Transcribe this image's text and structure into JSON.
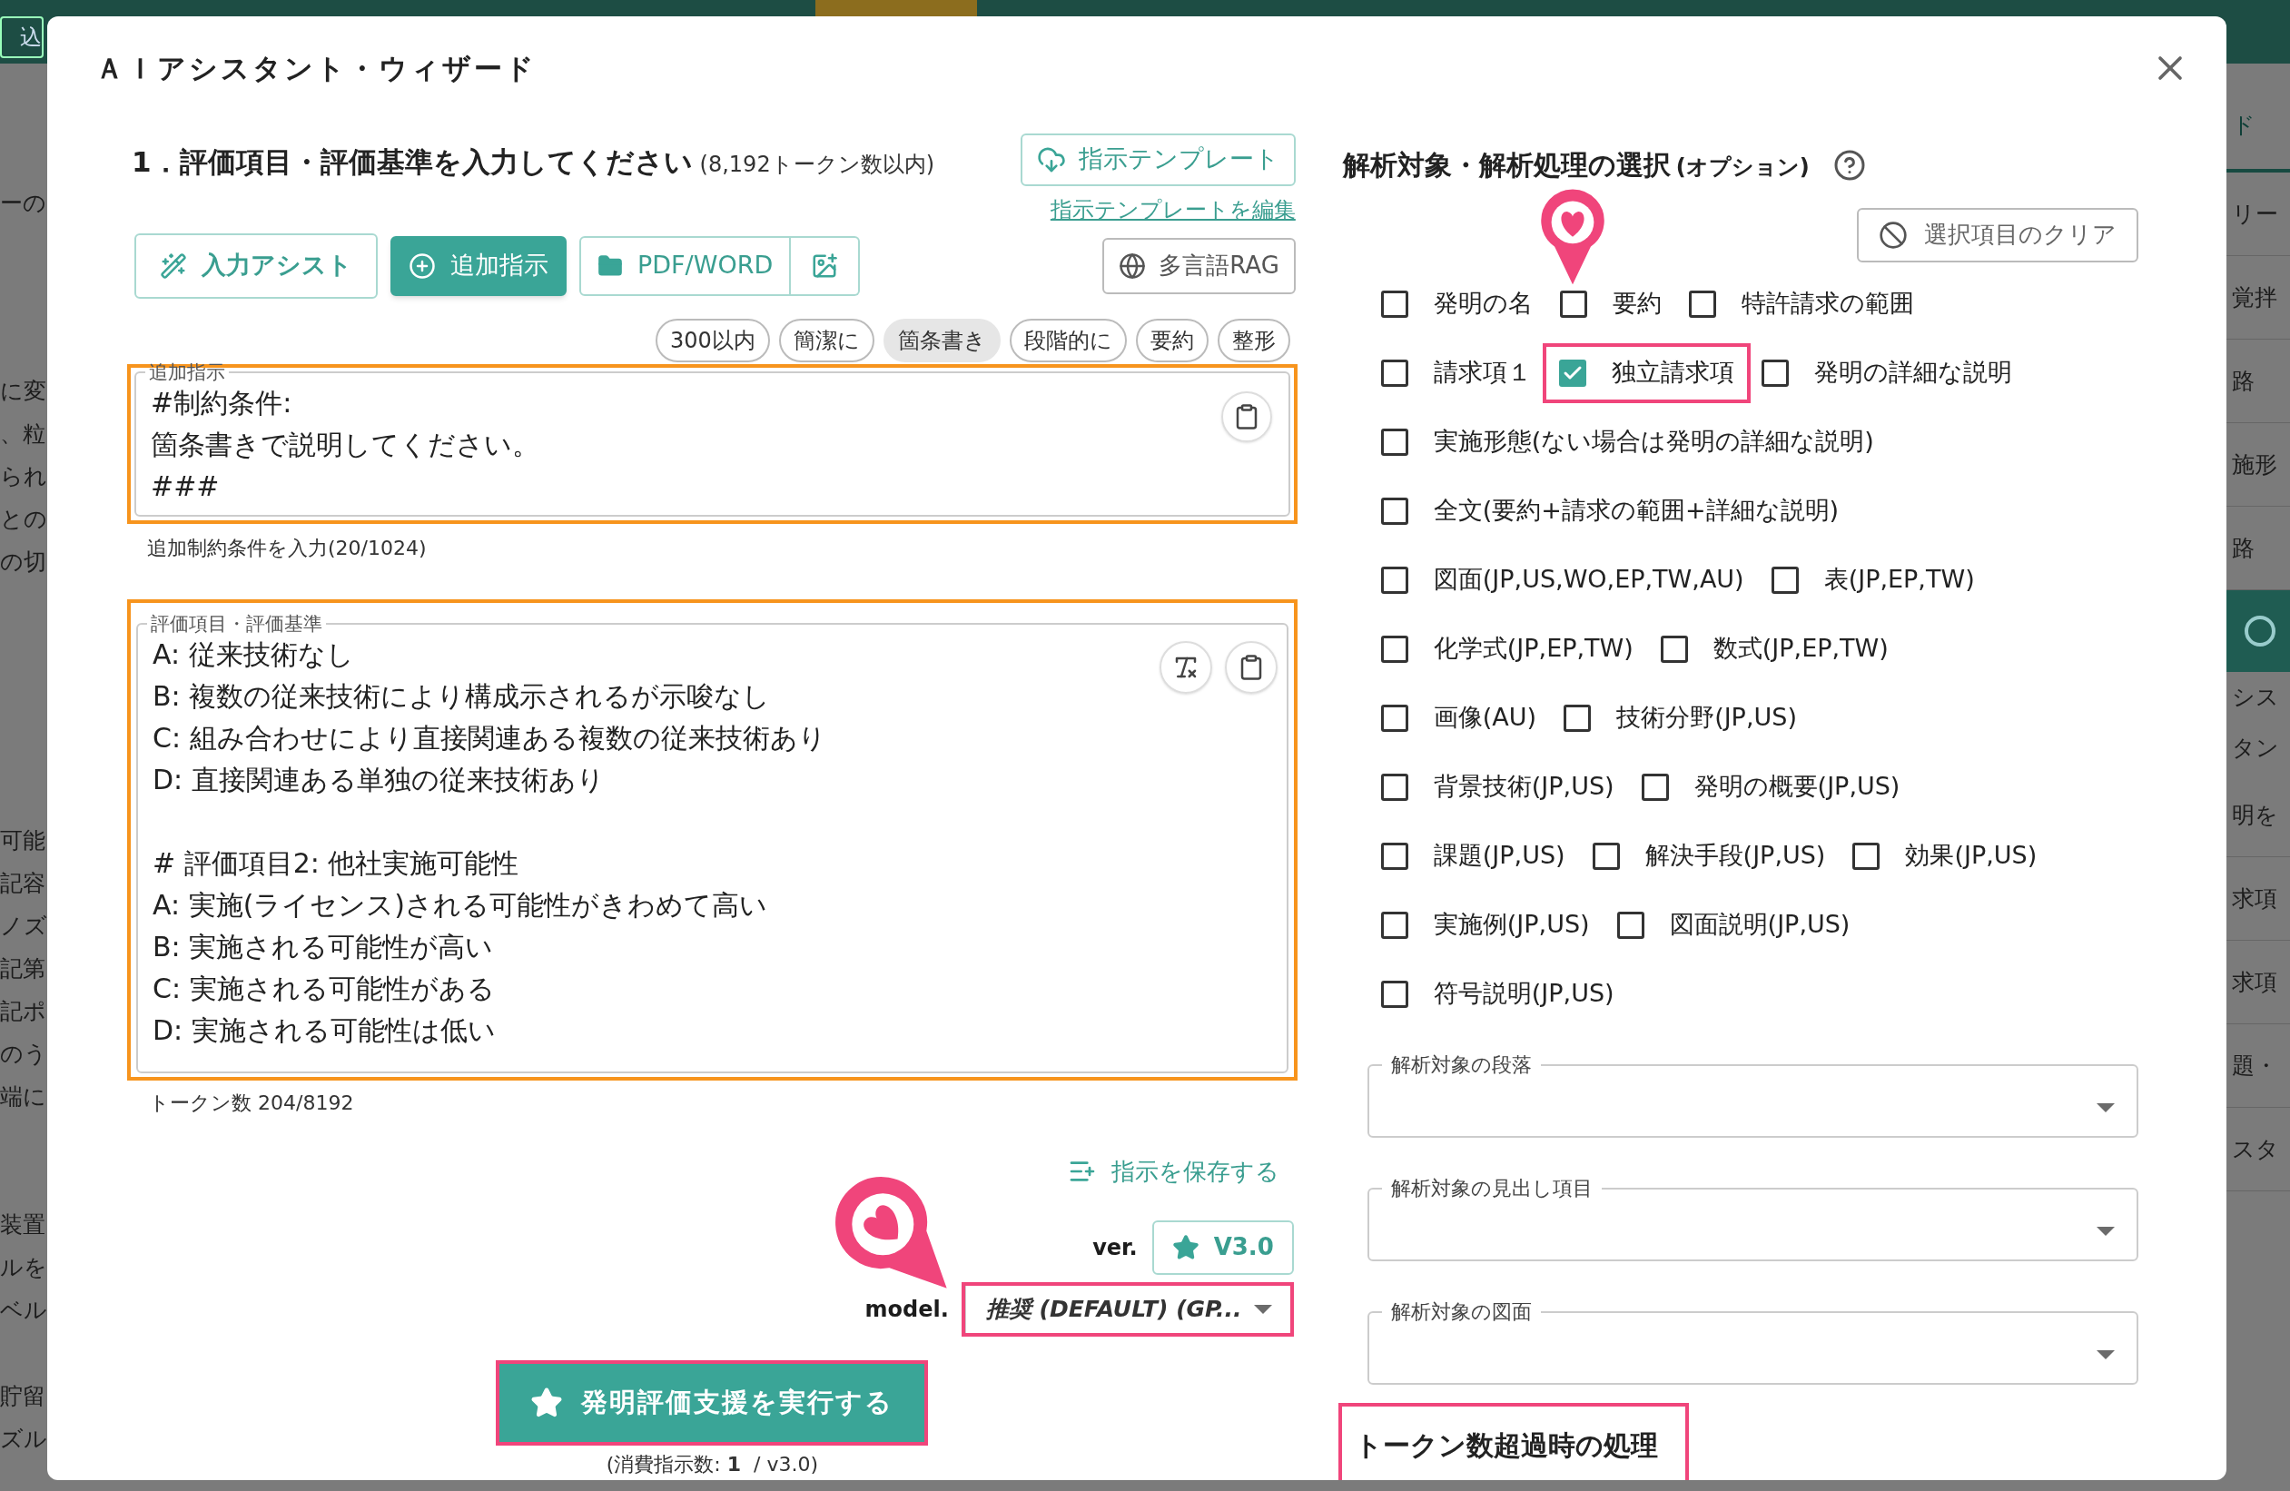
{
  "background": {
    "top_button": "込",
    "left_fragments": [
      [
        "ーの"
      ],
      [
        "に変",
        "、粒",
        "られ",
        "との",
        "の切"
      ],
      [
        "可能",
        "記容",
        "ノズ",
        "記第",
        "記ポ",
        "のう",
        "端に"
      ],
      [
        "装置",
        "ルを",
        "ベル"
      ],
      [
        "貯留",
        "ズル"
      ]
    ],
    "right_items": [
      {
        "text": "ド",
        "kind": "tab"
      },
      {
        "text": "リー",
        "kind": "row"
      },
      {
        "text": "覚拌",
        "kind": "row"
      },
      {
        "text": "路",
        "kind": "row"
      },
      {
        "text": "施形",
        "kind": "row"
      },
      {
        "text": "路",
        "kind": "row"
      },
      {
        "kind": "block"
      },
      {
        "text": "シス",
        "kind": "text"
      },
      {
        "text": "タン",
        "kind": "text"
      },
      {
        "text": "明を",
        "kind": "row"
      },
      {
        "text": "求項",
        "kind": "row"
      },
      {
        "text": "求項",
        "kind": "row"
      },
      {
        "text": "題・",
        "kind": "row"
      },
      {
        "text": "スタ",
        "kind": "row"
      }
    ]
  },
  "dialog": {
    "title": "ＡＩアシスタント・ウィザード"
  },
  "left": {
    "heading": "1．評価項目・評価基準を入力してください",
    "heading_note": "(8,192トークン数以内)",
    "template_button": "指示テンプレート",
    "template_link": "指示テンプレートを編集",
    "tools": [
      {
        "label": "入力アシスト",
        "kind": "assist"
      },
      {
        "label": "追加指示",
        "kind": "primary"
      },
      {
        "label": "PDF/WORD",
        "kind": "upload"
      },
      {
        "kind": "image"
      }
    ],
    "rag_button": "多言語RAG",
    "chips": [
      {
        "label": "300以内",
        "selected": false
      },
      {
        "label": "簡潔に",
        "selected": false
      },
      {
        "label": "箇条書き",
        "selected": true
      },
      {
        "label": "段階的に",
        "selected": false
      },
      {
        "label": "要約",
        "selected": false
      },
      {
        "label": "整形",
        "selected": false
      }
    ],
    "extra": {
      "legend": "追加指示",
      "value": "#制約条件:\n箇条書きで説明してください。\n###",
      "helper": "追加制約条件を入力(20/1024)",
      "highlighted": true
    },
    "criteria": {
      "legend": "評価項目・評価基準",
      "value": "A: 従来技術なし\nB: 複数の従来技術により構成示されるが示唆なし\nC: 組み合わせにより直接関連ある複数の従来技術あり\nD: 直接関連ある単独の従来技術あり\n\n# 評価項目2: 他社実施可能性\nA: 実施(ライセンス)される可能性がきわめて高い\nB: 実施される可能性が高い\nC: 実施される可能性がある\nD: 実施される可能性は低い",
      "highlighted": true
    },
    "token_count": "トークン数 204/8192",
    "save_link": "指示を保存する",
    "ver_label": "ver.",
    "version_button": "V3.0",
    "model_label": "model.",
    "model_value": "推奨 (DEFAULT) (GP...",
    "model_highlighted": true,
    "run_button": "発明評価支援を実行する",
    "run_highlighted": true,
    "consumption": "(消費指示数: **1**  / v3.0)"
  },
  "right": {
    "heading": "解析対象・解析処理の選択",
    "heading_note": "(オプション)",
    "clear_button": "選択項目のクリア",
    "option_rows": [
      [
        {
          "label": "発明の名",
          "checked": false,
          "highlighted": false
        },
        {
          "label": "要約",
          "checked": false,
          "highlighted": false
        },
        {
          "label": "特許請求の範囲",
          "checked": false,
          "highlighted": false
        }
      ],
      [
        {
          "label": "請求項１",
          "checked": false,
          "highlighted": false
        },
        {
          "label": "独立請求項",
          "checked": true,
          "highlighted": true
        },
        {
          "label": "発明の詳細な説明",
          "checked": false,
          "highlighted": false
        }
      ],
      [
        {
          "label": "実施形態(ない場合は発明の詳細な説明)",
          "checked": false,
          "highlighted": false
        }
      ],
      [
        {
          "label": "全文(要約+請求の範囲+詳細な説明)",
          "checked": false,
          "highlighted": false
        }
      ],
      [
        {
          "label": "図面(JP,US,WO,EP,TW,AU)",
          "checked": false,
          "highlighted": false
        },
        {
          "label": "表(JP,EP,TW)",
          "checked": false,
          "highlighted": false
        }
      ],
      [
        {
          "label": "化学式(JP,EP,TW)",
          "checked": false,
          "highlighted": false
        },
        {
          "label": "数式(JP,EP,TW)",
          "checked": false,
          "highlighted": false
        }
      ],
      [
        {
          "label": "画像(AU)",
          "checked": false,
          "highlighted": false
        },
        {
          "label": "技術分野(JP,US)",
          "checked": false,
          "highlighted": false
        }
      ],
      [
        {
          "label": "背景技術(JP,US)",
          "checked": false,
          "highlighted": false
        },
        {
          "label": "発明の概要(JP,US)",
          "checked": false,
          "highlighted": false
        }
      ],
      [
        {
          "label": "課題(JP,US)",
          "checked": false,
          "highlighted": false
        },
        {
          "label": "解決手段(JP,US)",
          "checked": false,
          "highlighted": false
        },
        {
          "label": "効果(JP,US)",
          "checked": false,
          "highlighted": false
        }
      ],
      [
        {
          "label": "実施例(JP,US)",
          "checked": false,
          "highlighted": false
        },
        {
          "label": "図面説明(JP,US)",
          "checked": false,
          "highlighted": false
        }
      ],
      [
        {
          "label": "符号説明(JP,US)",
          "checked": false,
          "highlighted": false
        }
      ]
    ],
    "selects": [
      {
        "label": "解析対象の段落"
      },
      {
        "label": "解析対象の見出し項目"
      },
      {
        "label": "解析対象の図面"
      }
    ],
    "section_heading": "トークン数超過時の処理",
    "section_highlighted": true
  }
}
